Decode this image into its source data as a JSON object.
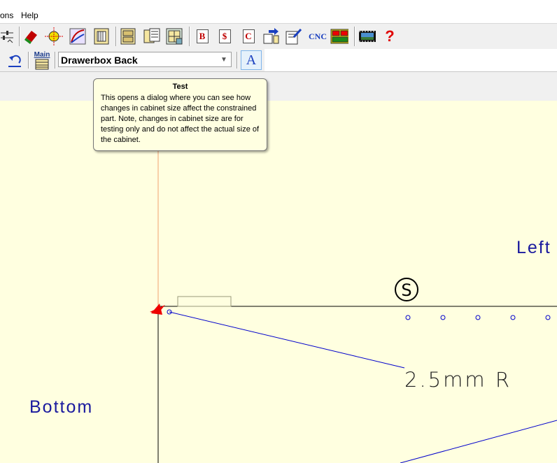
{
  "menu": {
    "options": "ons",
    "help": "Help"
  },
  "toolbar1": {
    "b_glyph": "B",
    "s_glyph": "$",
    "c_glyph": "C",
    "cnc_label": "CNC",
    "help_glyph": "?"
  },
  "toolbar2": {
    "main_label": "Main",
    "part_selected": "Drawerbox Back",
    "test_glyph": "A"
  },
  "tooltip": {
    "title": "Test",
    "body": "This opens a dialog where you can see how changes in cabinet size affect the constrained part. Note, changes in cabinet size are for testing only and do not affect the actual size of the cabinet."
  },
  "canvas": {
    "left_label": "Left",
    "bottom_label": "Bottom",
    "s_marker": "S",
    "dimension_label": "2.5mm R"
  },
  "colors": {
    "canvas_bg": "#ffffe0",
    "label_blue": "#1a1a9e",
    "dim_line": "#0000cc",
    "arrow": "#ee0000",
    "guide": "#f0a070"
  }
}
